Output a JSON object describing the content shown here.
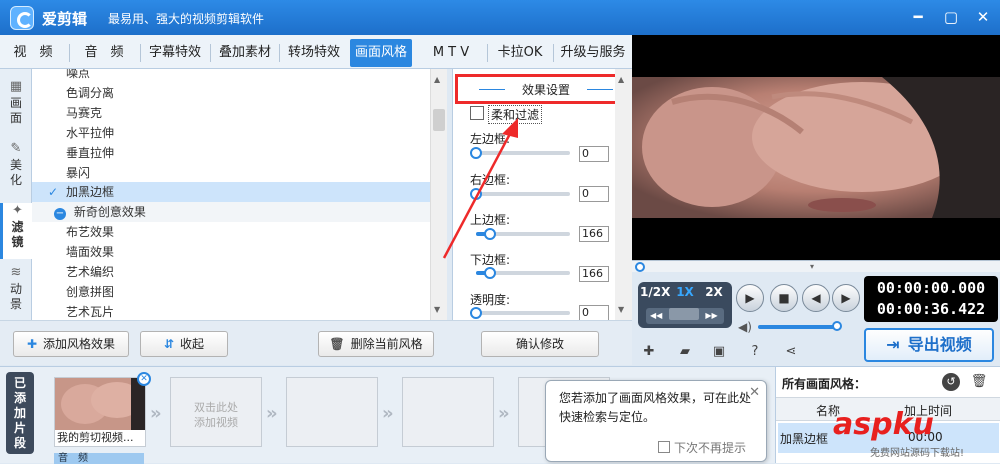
{
  "app": {
    "name": "爱剪辑",
    "slogan": "最易用、强大的视频剪辑软件"
  },
  "tabs": [
    {
      "label": "视　频"
    },
    {
      "label": "音　频"
    },
    {
      "label": "字幕特效"
    },
    {
      "label": "叠加素材"
    },
    {
      "label": "转场特效"
    },
    {
      "label": "画面风格",
      "active": true
    },
    {
      "label": "M T V"
    },
    {
      "label": "卡拉OK"
    },
    {
      "label": "升级与服务"
    }
  ],
  "side_tabs": [
    {
      "label": "画面"
    },
    {
      "label": "美化"
    },
    {
      "label": "滤镜",
      "active": true
    },
    {
      "label": "动景"
    }
  ],
  "style_list": [
    {
      "label": "噪点"
    },
    {
      "label": "色调分离"
    },
    {
      "label": "马赛克"
    },
    {
      "label": "水平拉伸"
    },
    {
      "label": "垂直拉伸"
    },
    {
      "label": "暴闪"
    },
    {
      "label": "加黑边框",
      "selected": true
    },
    {
      "label": "新奇创意效果",
      "group": true
    },
    {
      "label": "布艺效果"
    },
    {
      "label": "墙面效果"
    },
    {
      "label": "艺术编织"
    },
    {
      "label": "创意拼图"
    },
    {
      "label": "艺术瓦片"
    }
  ],
  "effect": {
    "title": "效果设置",
    "soft_filter": "柔和过滤",
    "sliders": [
      {
        "label": "左边框:",
        "value": "0",
        "level": 0
      },
      {
        "label": "右边框:",
        "value": "0",
        "level": 0
      },
      {
        "label": "上边框:",
        "value": "166",
        "level": 0.15
      },
      {
        "label": "下边框:",
        "value": "166",
        "level": 0.15
      },
      {
        "label": "透明度:",
        "value": "0",
        "level": 0
      }
    ],
    "confirm": "确认修改"
  },
  "toolbar": {
    "add": "添加风格效果",
    "collapse": "收起",
    "delete": "删除当前风格"
  },
  "player": {
    "speeds": [
      "1/2X",
      "1X",
      "2X"
    ],
    "active_speed": "1X",
    "current_time": "00:00:00.000",
    "total_time": "00:00:36.422"
  },
  "export_label": "导出视频",
  "clips": {
    "label": "已添加片段",
    "clip_title": "我的剪切视频...",
    "placeholder": "双击此处添加视频",
    "audio_label": "音　频"
  },
  "tooltip": {
    "text": "您若添加了画面风格效果，可在此处快速检索与定位。",
    "dont_show": "下次不再提示"
  },
  "styles_panel": {
    "title": "所有画面风格：",
    "col_name": "名称",
    "col_time": "加上时间",
    "row_name": "加黑边框",
    "row_time": "00:00"
  },
  "watermark": {
    "text": "aspku",
    "sub": "免费网站源码下载站!"
  }
}
